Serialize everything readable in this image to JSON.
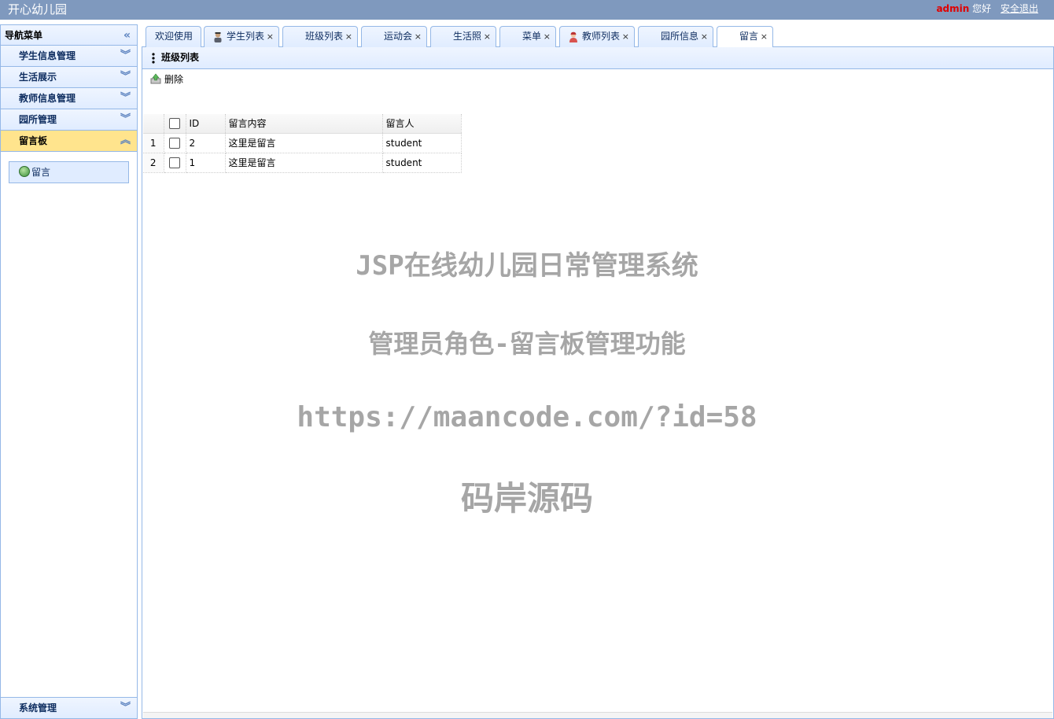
{
  "app": {
    "title": "开心幼儿园"
  },
  "user": {
    "name": "admin",
    "greeting": "您好",
    "logout": "安全退出"
  },
  "nav": {
    "header": "导航菜单",
    "sections": [
      {
        "label": "学生信息管理"
      },
      {
        "label": "生活展示"
      },
      {
        "label": "教师信息管理"
      },
      {
        "label": "园所管理"
      },
      {
        "label": "留言板"
      }
    ],
    "open_items": [
      {
        "label": "留言"
      }
    ],
    "bottom_section": "系统管理"
  },
  "tabs": [
    {
      "label": "欢迎使用"
    },
    {
      "label": "学生列表"
    },
    {
      "label": "班级列表"
    },
    {
      "label": "运动会"
    },
    {
      "label": "生活照"
    },
    {
      "label": "菜单"
    },
    {
      "label": "教师列表"
    },
    {
      "label": "园所信息"
    },
    {
      "label": "留言"
    }
  ],
  "panel": {
    "title": "班级列表",
    "toolbar_delete": "删除",
    "columns": [
      "ID",
      "留言内容",
      "留言人"
    ],
    "rows": [
      {
        "rn": "1",
        "id": "2",
        "content": "这里是留言",
        "author": "student"
      },
      {
        "rn": "2",
        "id": "1",
        "content": "这里是留言",
        "author": "student"
      }
    ]
  },
  "watermark": {
    "line1": "JSP在线幼儿园日常管理系统",
    "line2": "管理员角色-留言板管理功能",
    "line3": "https://maancode.com/?id=58",
    "line4": "码岸源码"
  },
  "colors": {
    "accent": "#95b8e7",
    "header_bg": "#7f99be",
    "selected": "#ffe48d"
  }
}
